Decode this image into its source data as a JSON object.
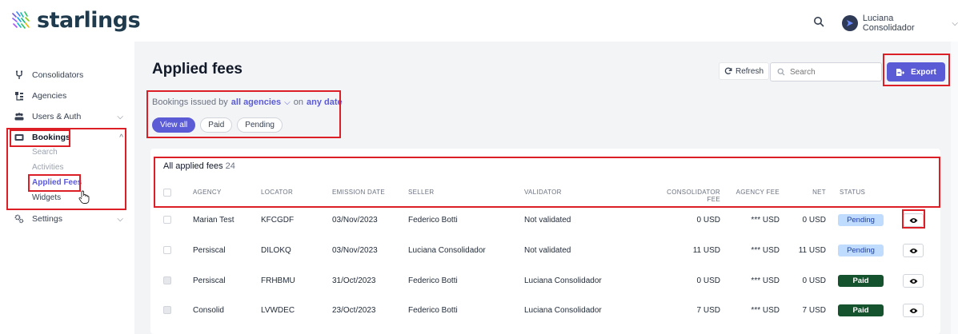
{
  "brand": {
    "name": "starlings"
  },
  "user": {
    "name": "Luciana Consolidador"
  },
  "sidebar": {
    "items": [
      {
        "label": "Consolidators",
        "icon": "fork-icon"
      },
      {
        "label": "Agencies",
        "icon": "agencies-icon"
      },
      {
        "label": "Users & Auth",
        "icon": "users-icon"
      },
      {
        "label": "Bookings",
        "icon": "bookings-icon"
      },
      {
        "label": "Settings",
        "icon": "settings-icon"
      }
    ],
    "bookings_sub": [
      "Search",
      "Activities",
      "Applied Fees",
      "Widgets"
    ]
  },
  "page": {
    "title": "Applied fees"
  },
  "filters": {
    "prefix": "Bookings issued by",
    "agencies_link": "all agencies",
    "on": "on",
    "date_link": "any date",
    "pills": [
      "View all",
      "Paid",
      "Pending"
    ]
  },
  "toolbar": {
    "refresh_label": "Refresh",
    "search_placeholder": "Search",
    "export_label": "Export"
  },
  "table": {
    "title": "All applied fees",
    "count": "24",
    "columns": [
      "AGENCY",
      "LOCATOR",
      "EMISSION DATE",
      "SELLER",
      "VALIDATOR",
      "CONSOLIDATOR FEE",
      "AGENCY FEE",
      "NET",
      "STATUS"
    ],
    "rows": [
      {
        "agency": "Marian Test",
        "locator": "KFCGDF",
        "date": "03/Nov/2023",
        "seller": "Federico Botti",
        "validator": "Not validated",
        "cons_fee": "0 USD",
        "agency_fee": "*** USD",
        "net": "0 USD",
        "status": "Pending"
      },
      {
        "agency": "Persiscal",
        "locator": "DILOKQ",
        "date": "03/Nov/2023",
        "seller": "Luciana Consolidador",
        "validator": "Not validated",
        "cons_fee": "11 USD",
        "agency_fee": "*** USD",
        "net": "11 USD",
        "status": "Pending"
      },
      {
        "agency": "Persiscal",
        "locator": "FRHBMU",
        "date": "31/Oct/2023",
        "seller": "Federico Botti",
        "validator": "Luciana Consolidador",
        "cons_fee": "0 USD",
        "agency_fee": "*** USD",
        "net": "0 USD",
        "status": "Paid"
      },
      {
        "agency": "Consolid",
        "locator": "LVWDEC",
        "date": "23/Oct/2023",
        "seller": "Federico Botti",
        "validator": "Luciana Consolidador",
        "cons_fee": "7 USD",
        "agency_fee": "*** USD",
        "net": "7 USD",
        "status": "Paid"
      }
    ]
  },
  "colors": {
    "accent": "#5b5bd6",
    "annotation": "#dc1f26",
    "paid": "#14532d",
    "pending": "#bfdbfe"
  }
}
